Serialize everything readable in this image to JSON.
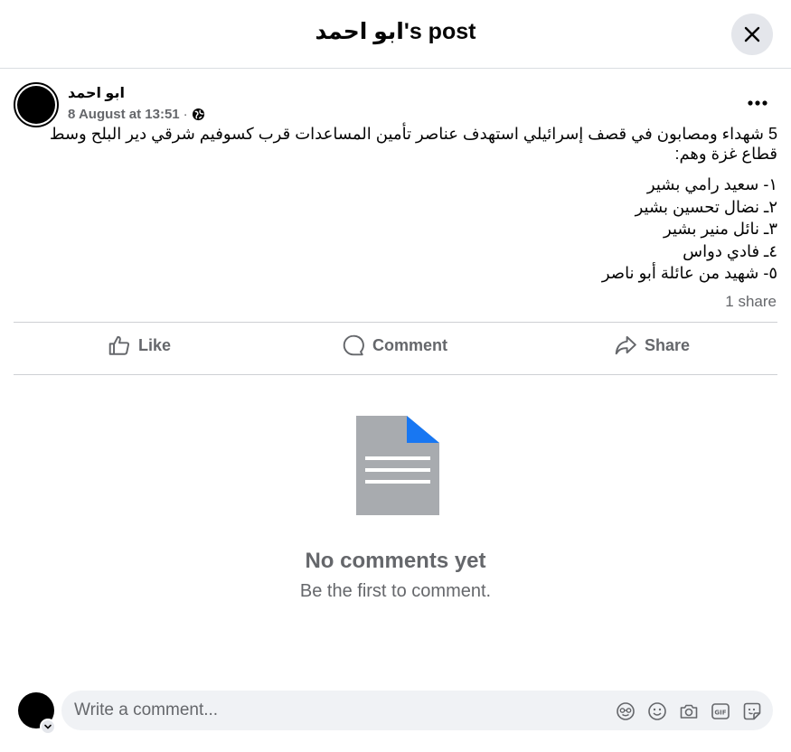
{
  "header": {
    "title": "ابو احمد's post"
  },
  "post": {
    "author": "ابو احمد",
    "timestamp": "8 August at 13:51",
    "separator": "·",
    "privacy_icon": "globe-icon",
    "lines": [
      "5 شهداء ومصابون في قصف إسرائيلي استهدف عناصر تأمين المساعدات قرب كسوفيم شرقي دير البلح وسط",
      "قطاع غزة وهم:"
    ],
    "list": [
      "١- سعيد رامي بشير",
      "٢ـ نضال تحسين بشير",
      "٣ـ نائل منير بشير",
      "٤ـ فادي دواس",
      "٥- شهيد من عائلة أبو ناصر"
    ],
    "share_count": "1 share"
  },
  "actions": {
    "like": "Like",
    "comment": "Comment",
    "share": "Share"
  },
  "empty_state": {
    "icon": "document-icon",
    "title": "No comments yet",
    "subtitle": "Be the first to comment."
  },
  "composer": {
    "placeholder": "Write a comment...",
    "tools": [
      "avatar-sticker-icon",
      "emoji-icon",
      "camera-icon",
      "gif-icon",
      "sticker-icon"
    ]
  },
  "colors": {
    "primary_text": "#050505",
    "secondary_text": "#65676b",
    "divider": "#ced0d4",
    "button_bg": "#e4e6eb",
    "input_bg": "#f0f2f5",
    "accent": "#1877f2"
  }
}
